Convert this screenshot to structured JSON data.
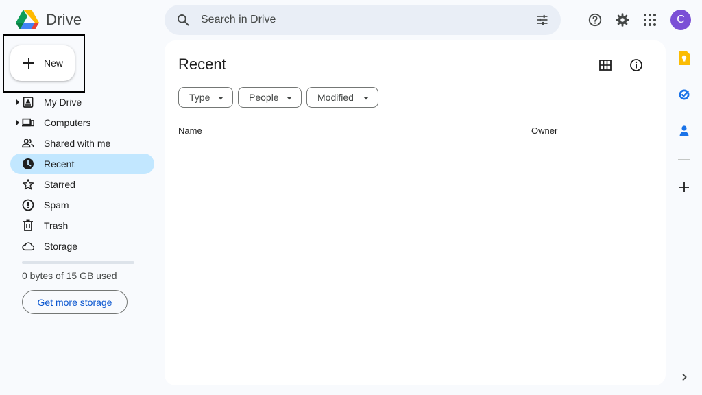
{
  "app": {
    "name": "Drive"
  },
  "header": {
    "search_placeholder": "Search in Drive",
    "avatar_initial": "C"
  },
  "new_button": {
    "label": "New"
  },
  "sidebar": {
    "items": [
      {
        "label": "My Drive",
        "icon": "my-drive-icon",
        "expandable": true,
        "active": false
      },
      {
        "label": "Computers",
        "icon": "computers-icon",
        "expandable": true,
        "active": false
      },
      {
        "label": "Shared with me",
        "icon": "people-icon",
        "expandable": false,
        "active": false
      },
      {
        "label": "Recent",
        "icon": "clock-icon",
        "expandable": false,
        "active": true
      },
      {
        "label": "Starred",
        "icon": "star-icon",
        "expandable": false,
        "active": false
      },
      {
        "label": "Spam",
        "icon": "spam-icon",
        "expandable": false,
        "active": false
      },
      {
        "label": "Trash",
        "icon": "trash-icon",
        "expandable": false,
        "active": false
      },
      {
        "label": "Storage",
        "icon": "cloud-icon",
        "expandable": false,
        "active": false
      }
    ],
    "storage": {
      "used_fraction": 0,
      "text": "0 bytes of 15 GB used",
      "button_label": "Get more storage"
    }
  },
  "main": {
    "title": "Recent",
    "filters": [
      {
        "label": "Type"
      },
      {
        "label": "People"
      },
      {
        "label": "Modified"
      }
    ],
    "columns": {
      "name": "Name",
      "owner": "Owner"
    },
    "rows": []
  },
  "side_panel": {
    "apps": [
      "keep-icon",
      "tasks-icon",
      "contacts-icon"
    ]
  },
  "colors": {
    "background": "#f8fafd",
    "search_bg": "#e9eef6",
    "active_nav": "#c2e7ff",
    "link_blue": "#0b57d0",
    "avatar": "#7b4fd6"
  }
}
